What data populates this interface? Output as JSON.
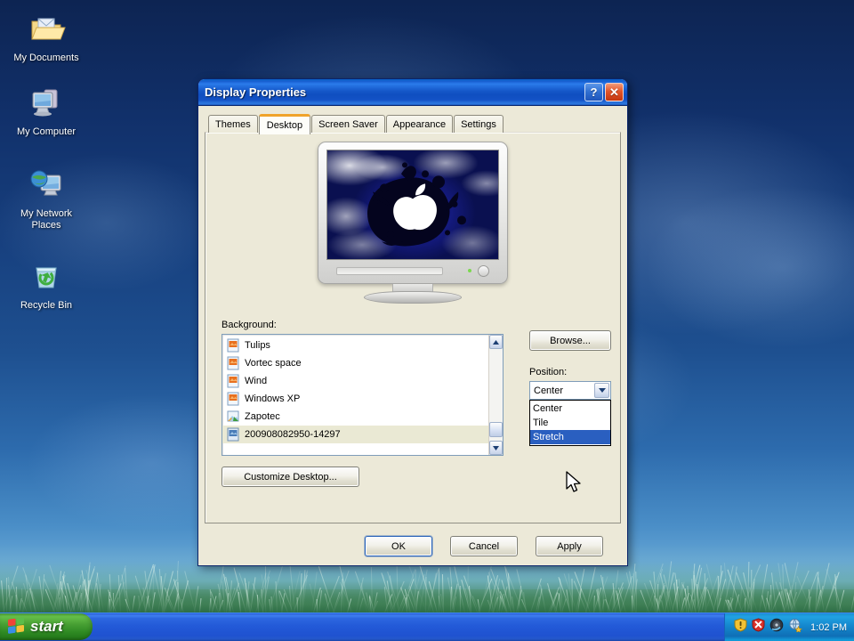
{
  "desktop": {
    "icons": [
      {
        "label": "My Documents",
        "icon": "my-documents-folder-icon"
      },
      {
        "label": "My Computer",
        "icon": "my-computer-icon"
      },
      {
        "label": "My Network Places",
        "icon": "my-network-places-icon"
      },
      {
        "label": "Recycle Bin",
        "icon": "recycle-bin-icon"
      }
    ]
  },
  "dialog": {
    "title": "Display Properties",
    "help_button": "?",
    "close_button": "✕",
    "tabs": [
      {
        "label": "Themes",
        "active": false
      },
      {
        "label": "Desktop",
        "active": true
      },
      {
        "label": "Screen Saver",
        "active": false
      },
      {
        "label": "Appearance",
        "active": false
      },
      {
        "label": "Settings",
        "active": false
      }
    ],
    "background_label": "Background:",
    "background_list": [
      {
        "label": "Tulips",
        "icon": "bitmap-file-icon",
        "selected": false
      },
      {
        "label": "Vortec space",
        "icon": "bitmap-file-icon",
        "selected": false
      },
      {
        "label": "Wind",
        "icon": "bitmap-file-icon",
        "selected": false
      },
      {
        "label": "Windows XP",
        "icon": "bitmap-file-icon",
        "selected": false
      },
      {
        "label": "Zapotec",
        "icon": "image-file-icon",
        "selected": false
      },
      {
        "label": "200908082950-14297",
        "icon": "bitmap-file-icon",
        "selected": true
      }
    ],
    "browse_button": "Browse...",
    "position_label": "Position:",
    "position_value": "Center",
    "position_options": [
      {
        "label": "Center",
        "selected": false
      },
      {
        "label": "Tile",
        "selected": false
      },
      {
        "label": "Stretch",
        "selected": true
      }
    ],
    "customize_button": "Customize Desktop...",
    "ok_button": "OK",
    "cancel_button": "Cancel",
    "apply_button": "Apply",
    "colors": {
      "titlebar_blue": "#1558c9",
      "dialog_face": "#ece9d8",
      "active_tab_accent": "#f0a32b",
      "selection_blue": "#2a5fc0",
      "inactive_selection": "#eae9d4"
    }
  },
  "taskbar": {
    "start_label": "start",
    "start_icon": "windows-flag-icon",
    "tray_icons": [
      {
        "name": "security-alert-shield-icon"
      },
      {
        "name": "antivirus-shield-icon"
      },
      {
        "name": "media-disc-icon"
      },
      {
        "name": "updates-globe-icon"
      }
    ],
    "clock": "1:02 PM"
  }
}
